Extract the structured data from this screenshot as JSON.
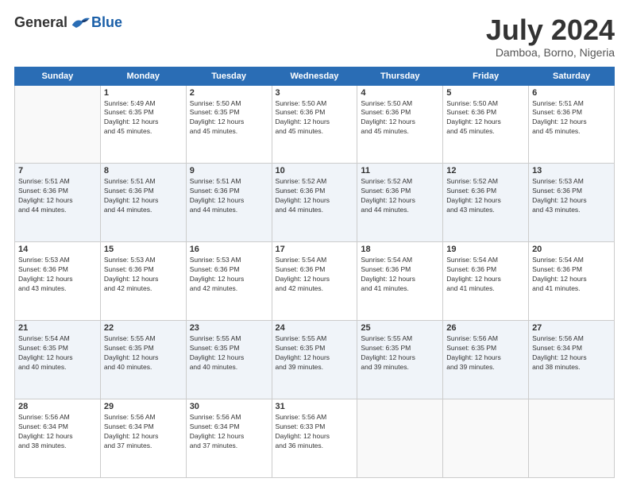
{
  "header": {
    "logo_general": "General",
    "logo_blue": "Blue",
    "month_title": "July 2024",
    "location": "Damboa, Borno, Nigeria"
  },
  "weekdays": [
    "Sunday",
    "Monday",
    "Tuesday",
    "Wednesday",
    "Thursday",
    "Friday",
    "Saturday"
  ],
  "weeks": [
    [
      {
        "day": "",
        "sunrise": "",
        "sunset": "",
        "daylight": ""
      },
      {
        "day": "1",
        "sunrise": "Sunrise: 5:49 AM",
        "sunset": "Sunset: 6:35 PM",
        "daylight": "Daylight: 12 hours and 45 minutes."
      },
      {
        "day": "2",
        "sunrise": "Sunrise: 5:50 AM",
        "sunset": "Sunset: 6:35 PM",
        "daylight": "Daylight: 12 hours and 45 minutes."
      },
      {
        "day": "3",
        "sunrise": "Sunrise: 5:50 AM",
        "sunset": "Sunset: 6:36 PM",
        "daylight": "Daylight: 12 hours and 45 minutes."
      },
      {
        "day": "4",
        "sunrise": "Sunrise: 5:50 AM",
        "sunset": "Sunset: 6:36 PM",
        "daylight": "Daylight: 12 hours and 45 minutes."
      },
      {
        "day": "5",
        "sunrise": "Sunrise: 5:50 AM",
        "sunset": "Sunset: 6:36 PM",
        "daylight": "Daylight: 12 hours and 45 minutes."
      },
      {
        "day": "6",
        "sunrise": "Sunrise: 5:51 AM",
        "sunset": "Sunset: 6:36 PM",
        "daylight": "Daylight: 12 hours and 45 minutes."
      }
    ],
    [
      {
        "day": "7",
        "sunrise": "Sunrise: 5:51 AM",
        "sunset": "Sunset: 6:36 PM",
        "daylight": "Daylight: 12 hours and 44 minutes."
      },
      {
        "day": "8",
        "sunrise": "Sunrise: 5:51 AM",
        "sunset": "Sunset: 6:36 PM",
        "daylight": "Daylight: 12 hours and 44 minutes."
      },
      {
        "day": "9",
        "sunrise": "Sunrise: 5:51 AM",
        "sunset": "Sunset: 6:36 PM",
        "daylight": "Daylight: 12 hours and 44 minutes."
      },
      {
        "day": "10",
        "sunrise": "Sunrise: 5:52 AM",
        "sunset": "Sunset: 6:36 PM",
        "daylight": "Daylight: 12 hours and 44 minutes."
      },
      {
        "day": "11",
        "sunrise": "Sunrise: 5:52 AM",
        "sunset": "Sunset: 6:36 PM",
        "daylight": "Daylight: 12 hours and 44 minutes."
      },
      {
        "day": "12",
        "sunrise": "Sunrise: 5:52 AM",
        "sunset": "Sunset: 6:36 PM",
        "daylight": "Daylight: 12 hours and 43 minutes."
      },
      {
        "day": "13",
        "sunrise": "Sunrise: 5:53 AM",
        "sunset": "Sunset: 6:36 PM",
        "daylight": "Daylight: 12 hours and 43 minutes."
      }
    ],
    [
      {
        "day": "14",
        "sunrise": "Sunrise: 5:53 AM",
        "sunset": "Sunset: 6:36 PM",
        "daylight": "Daylight: 12 hours and 43 minutes."
      },
      {
        "day": "15",
        "sunrise": "Sunrise: 5:53 AM",
        "sunset": "Sunset: 6:36 PM",
        "daylight": "Daylight: 12 hours and 42 minutes."
      },
      {
        "day": "16",
        "sunrise": "Sunrise: 5:53 AM",
        "sunset": "Sunset: 6:36 PM",
        "daylight": "Daylight: 12 hours and 42 minutes."
      },
      {
        "day": "17",
        "sunrise": "Sunrise: 5:54 AM",
        "sunset": "Sunset: 6:36 PM",
        "daylight": "Daylight: 12 hours and 42 minutes."
      },
      {
        "day": "18",
        "sunrise": "Sunrise: 5:54 AM",
        "sunset": "Sunset: 6:36 PM",
        "daylight": "Daylight: 12 hours and 41 minutes."
      },
      {
        "day": "19",
        "sunrise": "Sunrise: 5:54 AM",
        "sunset": "Sunset: 6:36 PM",
        "daylight": "Daylight: 12 hours and 41 minutes."
      },
      {
        "day": "20",
        "sunrise": "Sunrise: 5:54 AM",
        "sunset": "Sunset: 6:36 PM",
        "daylight": "Daylight: 12 hours and 41 minutes."
      }
    ],
    [
      {
        "day": "21",
        "sunrise": "Sunrise: 5:54 AM",
        "sunset": "Sunset: 6:35 PM",
        "daylight": "Daylight: 12 hours and 40 minutes."
      },
      {
        "day": "22",
        "sunrise": "Sunrise: 5:55 AM",
        "sunset": "Sunset: 6:35 PM",
        "daylight": "Daylight: 12 hours and 40 minutes."
      },
      {
        "day": "23",
        "sunrise": "Sunrise: 5:55 AM",
        "sunset": "Sunset: 6:35 PM",
        "daylight": "Daylight: 12 hours and 40 minutes."
      },
      {
        "day": "24",
        "sunrise": "Sunrise: 5:55 AM",
        "sunset": "Sunset: 6:35 PM",
        "daylight": "Daylight: 12 hours and 39 minutes."
      },
      {
        "day": "25",
        "sunrise": "Sunrise: 5:55 AM",
        "sunset": "Sunset: 6:35 PM",
        "daylight": "Daylight: 12 hours and 39 minutes."
      },
      {
        "day": "26",
        "sunrise": "Sunrise: 5:56 AM",
        "sunset": "Sunset: 6:35 PM",
        "daylight": "Daylight: 12 hours and 39 minutes."
      },
      {
        "day": "27",
        "sunrise": "Sunrise: 5:56 AM",
        "sunset": "Sunset: 6:34 PM",
        "daylight": "Daylight: 12 hours and 38 minutes."
      }
    ],
    [
      {
        "day": "28",
        "sunrise": "Sunrise: 5:56 AM",
        "sunset": "Sunset: 6:34 PM",
        "daylight": "Daylight: 12 hours and 38 minutes."
      },
      {
        "day": "29",
        "sunrise": "Sunrise: 5:56 AM",
        "sunset": "Sunset: 6:34 PM",
        "daylight": "Daylight: 12 hours and 37 minutes."
      },
      {
        "day": "30",
        "sunrise": "Sunrise: 5:56 AM",
        "sunset": "Sunset: 6:34 PM",
        "daylight": "Daylight: 12 hours and 37 minutes."
      },
      {
        "day": "31",
        "sunrise": "Sunrise: 5:56 AM",
        "sunset": "Sunset: 6:33 PM",
        "daylight": "Daylight: 12 hours and 36 minutes."
      },
      {
        "day": "",
        "sunrise": "",
        "sunset": "",
        "daylight": ""
      },
      {
        "day": "",
        "sunrise": "",
        "sunset": "",
        "daylight": ""
      },
      {
        "day": "",
        "sunrise": "",
        "sunset": "",
        "daylight": ""
      }
    ]
  ]
}
